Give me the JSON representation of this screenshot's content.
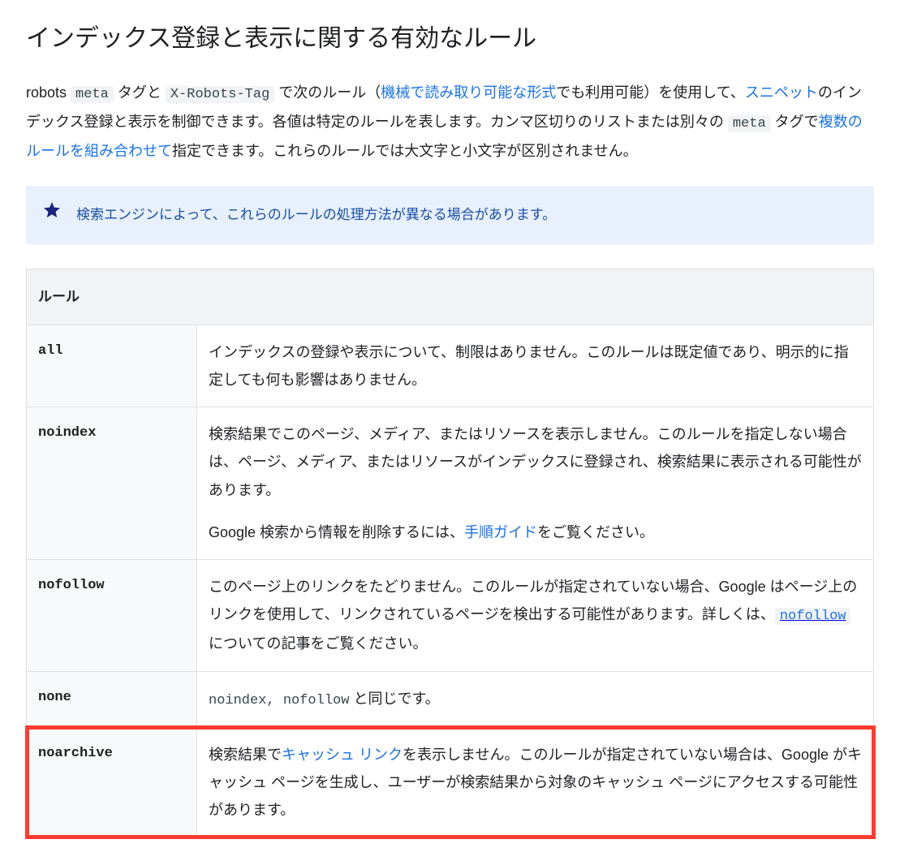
{
  "heading": "インデックス登録と表示に関する有効なルール",
  "intro": {
    "t1": "robots ",
    "code1": "meta",
    "t2": " タグと ",
    "code2": "X-Robots-Tag",
    "t3": " で次のルール（",
    "link1": "機械で読み取り可能な形式",
    "t4": "でも利用可能）を使用して、",
    "link2": "スニペット",
    "t5": "のインデックス登録と表示を制御できます。各値は特定のルールを表します。カンマ区切りのリストまたは別々の ",
    "code3": "meta",
    "t6": " タグで",
    "link3": "複数のルールを組み合わせて",
    "t7": "指定できます。これらのルールでは大文字と小文字が区別されません。"
  },
  "note": "検索エンジンによって、これらのルールの処理方法が異なる場合があります。",
  "table": {
    "header": "ルール",
    "rows": {
      "all": {
        "name": "all",
        "desc": "インデックスの登録や表示について、制限はありません。このルールは既定値であり、明示的に指定しても何も影響はありません。"
      },
      "noindex": {
        "name": "noindex",
        "p1": "検索結果でこのページ、メディア、またはリソースを表示しません。このルールを指定しない場合は、ページ、メディア、またはリソースがインデックスに登録され、検索結果に表示される可能性があります。",
        "p2a": "Google 検索から情報を削除するには、",
        "p2link": "手順ガイド",
        "p2b": "をご覧ください。"
      },
      "nofollow": {
        "name": "nofollow",
        "t1": "このページ上のリンクをたどりません。このルールが指定されていない場合、Google はページ上のリンクを使用して、リンクされているページを検出する可能性があります。詳しくは、",
        "code": "nofollow",
        "t2": " についての記事をご覧ください。"
      },
      "none": {
        "name": "none",
        "code": "noindex, nofollow",
        "t": " と同じです。"
      },
      "noarchive": {
        "name": "noarchive",
        "t1": "検索結果で",
        "link": "キャッシュ リンク",
        "t2": "を表示しません。このルールが指定されていない場合は、Google がキャッシュ ページを生成し、ユーザーが検索結果から対象のキャッシュ ページにアクセスする可能性があります。"
      }
    }
  }
}
